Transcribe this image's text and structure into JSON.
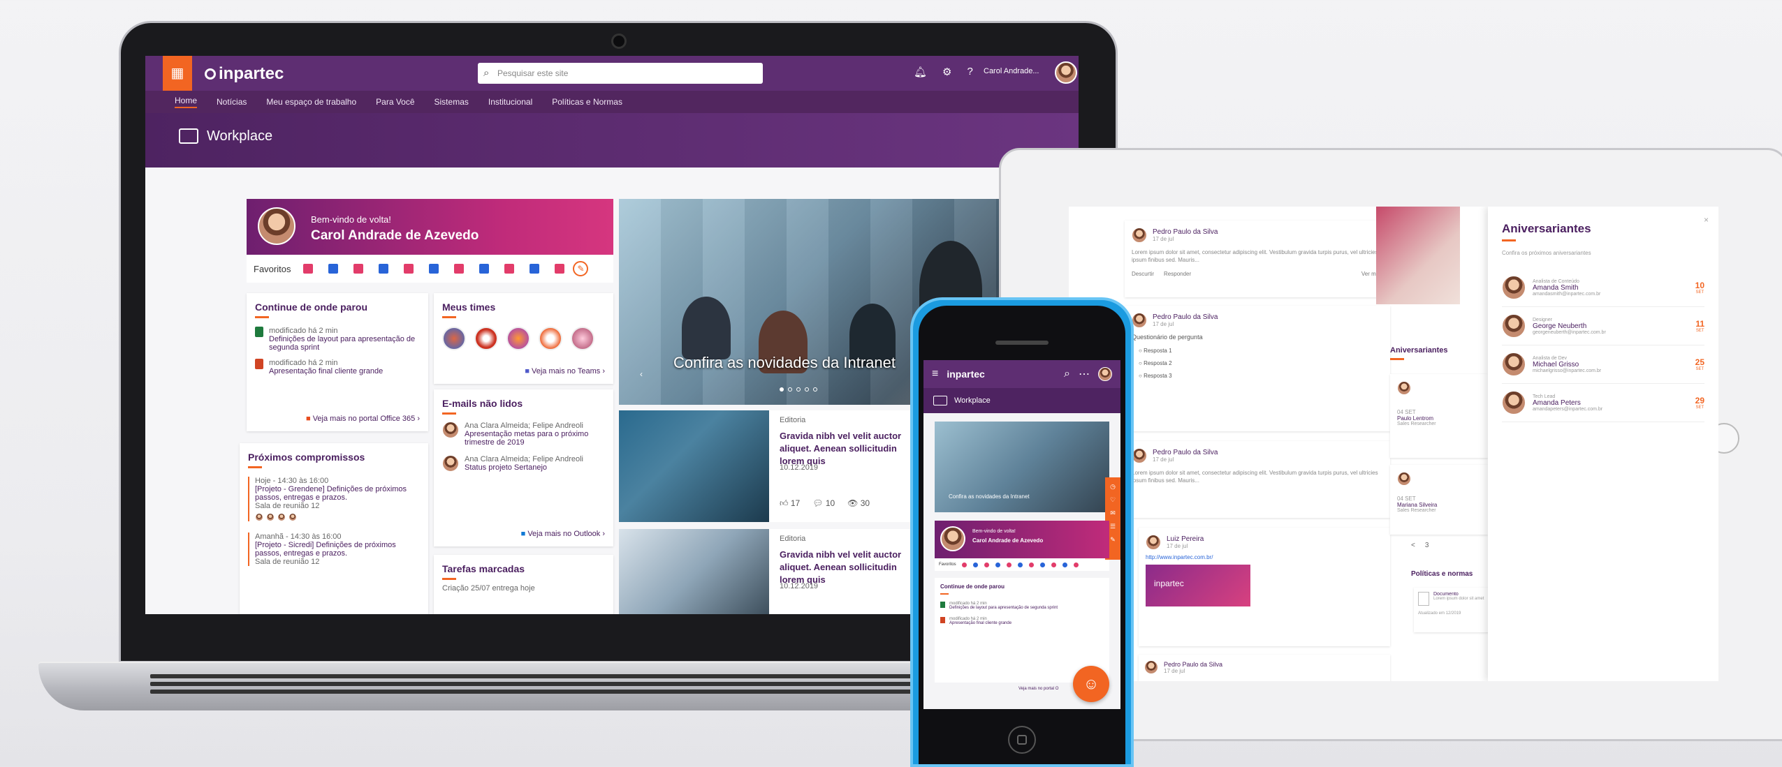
{
  "desktop": {
    "logo": "inpartec",
    "search_placeholder": "Pesquisar este site",
    "user_name": "Carol Andrade...",
    "nav": [
      "Home",
      "Notícias",
      "Meu espaço de trabalho",
      "Para Você",
      "Sistemas",
      "Institucional",
      "Políticas e Normas"
    ],
    "workplace_title": "Workplace",
    "welcome": {
      "greeting": "Bem-vindo de volta!",
      "name": "Carol Andrade de Azevedo"
    },
    "favorites_label": "Favoritos",
    "favorite_colors": [
      "#e23c6a",
      "#2864d8",
      "#e23c6a",
      "#2864d8",
      "#e23c6a",
      "#2864d8",
      "#e23c6a",
      "#2864d8",
      "#e23c6a",
      "#2864d8",
      "#e23c6a"
    ],
    "continue": {
      "title": "Continue de onde parou",
      "items": [
        {
          "time": "modificado há 2 min",
          "text": "Definições de layout para apresentação de segunda sprint"
        },
        {
          "time": "modificado há 2 min",
          "text": "Apresentação final cliente grande"
        }
      ],
      "link": "Veja mais no portal Office 365"
    },
    "teams": {
      "title": "Meus times",
      "link": "Veja mais no Teams"
    },
    "emails": {
      "title": "E-mails não lidos",
      "items": [
        {
          "from": "Ana Clara Almeida; Felipe Andreoli",
          "subject": "Apresentação metas para o próximo trimestre de 2019"
        },
        {
          "from": "Ana Clara Almeida; Felipe Andreoli",
          "subject": "Status projeto Sertanejo"
        }
      ],
      "link": "Veja mais no Outlook"
    },
    "agenda": {
      "title": "Próximos compromissos",
      "items": [
        {
          "when": "Hoje - 14:30 às 16:00",
          "what": "[Projeto - Grendene] Definições de próximos passos, entregas e prazos.",
          "where": "Sala de reunião 12"
        },
        {
          "when": "Amanhã - 14:30 às 16:00",
          "what": "[Projeto - Sicredi] Definições de próximos passos, entregas e prazos.",
          "where": "Sala de reunião 12"
        }
      ]
    },
    "tasks": {
      "title": "Tarefas marcadas",
      "item": "Criação 25/07 entrega hoje"
    },
    "hero_caption": "Confira as novidades da Intranet",
    "news": [
      {
        "label": "Editoria",
        "title": "Gravida nibh vel velit auctor aliquet. Aenean sollicitudin lorem quis",
        "date": "10.12.2019",
        "likes": "17",
        "comments": "10",
        "views": "30"
      },
      {
        "label": "Editoria",
        "title": "Gravida nibh vel velit auctor aliquet. Aenean sollicitudin lorem quis",
        "date": "10.12.2019"
      }
    ]
  },
  "phone": {
    "logo": "inpartec",
    "workplace": "Workplace",
    "hero_caption": "Confira as novidades da Intranet",
    "welcome": {
      "greeting": "Bem-vindo de volta!",
      "name": "Carol Andrade de Azevedo"
    },
    "favorites_label": "Favoritos",
    "continue_title": "Continue de onde parou",
    "items": [
      {
        "time": "modificado há 2 min",
        "text": "Definições de layout para apresentação de segunda sprint"
      },
      {
        "time": "modificado há 2 min",
        "text": "Apresentação final cliente grande"
      }
    ],
    "link": "Veja mais no portal O"
  },
  "tablet": {
    "birthdays_title": "Aniversariantes",
    "birthdays_subtitle": "Confira os próximos aniversariantes",
    "people": [
      {
        "role": "Analista de Conteúdo",
        "name": "Amanda Smith",
        "email": "amandasmith@inpartec.com.br",
        "day": "10",
        "month": "SET"
      },
      {
        "role": "Designer",
        "name": "George Neuberth",
        "email": "georgeneuberth@inpartec.com.br",
        "day": "11",
        "month": "SET"
      },
      {
        "role": "Analista de Dev",
        "name": "Michael Grisso",
        "email": "michaelgrisso@inpartec.com.br",
        "day": "25",
        "month": "SET"
      },
      {
        "role": "Tech Lead",
        "name": "Amanda Peters",
        "email": "amandapeters@inpartec.com.br",
        "day": "29",
        "month": "SET"
      }
    ],
    "posts": [
      {
        "author": "Pedro Paulo da Silva",
        "date": "17 de jul",
        "text": "Lorem ipsum dolor sit amet, consectetur adipiscing elit. Vestibulum gravida turpis purus, vel ultricies ipsum finibus sed. Mauris..."
      },
      {
        "author": "Pedro Paulo da Silva",
        "date": "17 de jul",
        "question": "Questionário de pergunta",
        "options": [
          "Resposta 1",
          "Resposta 2",
          "Resposta 3"
        ]
      },
      {
        "author": "Pedro Paulo da Silva",
        "date": "17 de jul",
        "text": "Lorem ipsum dolor sit amet, consectetur adipiscing elit. Vestibulum gravida turpis purus, vel ultricies ipsum finibus sed. Mauris..."
      },
      {
        "author": "Luiz Pereira",
        "date": "17 de jul",
        "link": "http://www.inpartec.com.br/",
        "preview": "inpartec"
      },
      {
        "author": "Pedro Paulo da Silva",
        "date": "17 de jul"
      }
    ],
    "actions": {
      "like": "Descurtir",
      "reply": "Responder",
      "more": "Ver mais"
    },
    "side_label": "Aniversariantes",
    "side_people": [
      {
        "date": "04 SET",
        "name": "Paulo Lentrom",
        "role": "Sales Researcher"
      },
      {
        "date": "04 SET",
        "name": "Mariana Silveira",
        "role": "Sales Researcher"
      }
    ],
    "pager": [
      "<",
      "3"
    ],
    "policies": "Políticas e normas",
    "policy_doc": {
      "title": "Documento",
      "sub": "Lorem ipsum dolor sit amet",
      "updated": "Atualizado em 12/2019"
    }
  }
}
